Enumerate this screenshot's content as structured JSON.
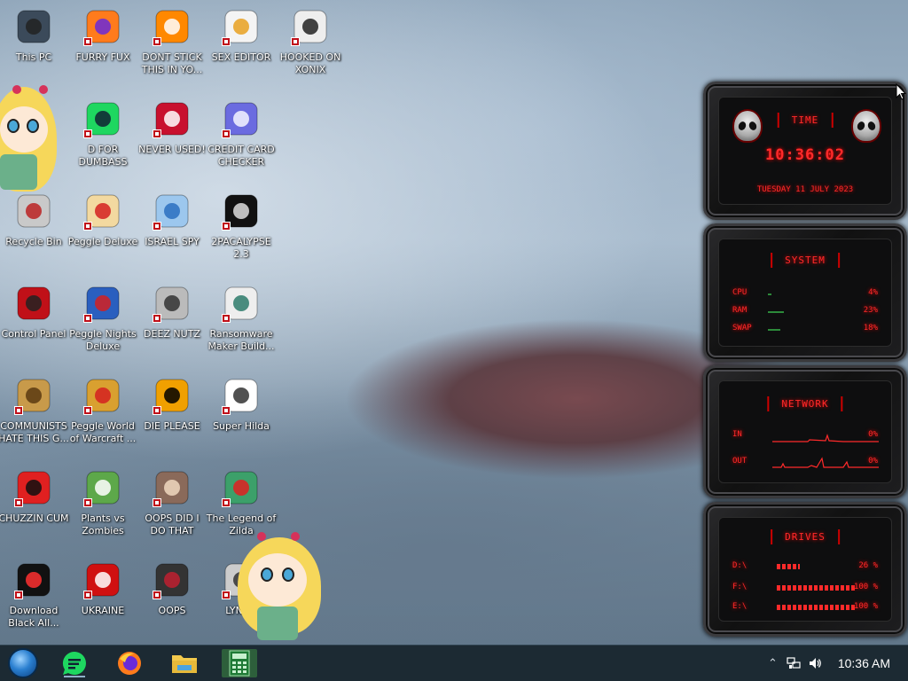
{
  "desktop": {
    "icons": [
      {
        "label": "This PC",
        "icon": "computer-icon"
      },
      {
        "label": "FURRY FUX",
        "icon": "firefox-icon"
      },
      {
        "label": "DONT STICK THIS IN YO...",
        "icon": "vlc-cone-icon"
      },
      {
        "label": "SEX EDITOR",
        "icon": "hxd-icon"
      },
      {
        "label": "HOOKED ON XONIX",
        "icon": "xonix-icon"
      },
      {
        "label": "D FOR DUMBASS",
        "icon": "dumbass-icon"
      },
      {
        "label": "NEVER USED!",
        "icon": "devcpp-icon"
      },
      {
        "label": "CREDIT CARD CHECKER",
        "icon": "credit-card-icon"
      },
      {
        "label": "Recycle Bin",
        "icon": "recycle-bin-icon"
      },
      {
        "label": "Peggle Deluxe",
        "icon": "peggle-icon"
      },
      {
        "label": "ISRAEL SPY",
        "icon": "network-spy-icon"
      },
      {
        "label": "2PACALYPSE 2.3",
        "icon": "terminal-icon"
      },
      {
        "label": "Control Panel",
        "icon": "control-panel-icon"
      },
      {
        "label": "Peggle Nights Deluxe",
        "icon": "peggle-nights-icon"
      },
      {
        "label": "DEEZ NUTZ",
        "icon": "windows-stack-icon"
      },
      {
        "label": "Ransomware Maker Build...",
        "icon": "window-app-icon"
      },
      {
        "label": "COMMUNISTS HATE THIS G...",
        "icon": "money-bag-icon"
      },
      {
        "label": "Peggle World of Warcraft ...",
        "icon": "peggle-wow-icon"
      },
      {
        "label": "DIE PLEASE",
        "icon": "de-icon"
      },
      {
        "label": "Super Hilda",
        "icon": "pixel-character-icon"
      },
      {
        "label": "CHUZZIN CUM",
        "icon": "chuzzle-icon"
      },
      {
        "label": "Plants vs Zombies",
        "icon": "pvz-icon"
      },
      {
        "label": "OOPS DID I DO THAT",
        "icon": "portrait-icon"
      },
      {
        "label": "The Legend of Zilda",
        "icon": "zilda-icon"
      },
      {
        "label": "Download Black All...",
        "icon": "black-orb-icon"
      },
      {
        "label": "UKRAINE",
        "icon": "radiation-icon"
      },
      {
        "label": "OOPS",
        "icon": "oops-icon"
      },
      {
        "label": "LYNCH",
        "icon": "magnifier-icon"
      }
    ]
  },
  "widget": {
    "time": {
      "title": "TIME",
      "clock": "10:36:02",
      "date": "TUESDAY 11 JULY 2023"
    },
    "system": {
      "title": "SYSTEM",
      "rows": [
        {
          "label": "CPU",
          "value": "4%",
          "level": 0.04
        },
        {
          "label": "RAM",
          "value": "23%",
          "level": 0.23
        },
        {
          "label": "SWAP",
          "value": "18%",
          "level": 0.18
        }
      ]
    },
    "network": {
      "title": "NETWORK",
      "rows": [
        {
          "label": "IN",
          "value": "0%"
        },
        {
          "label": "OUT",
          "value": "0%"
        }
      ]
    },
    "drives": {
      "title": "DRIVES",
      "rows": [
        {
          "label": "D:\\",
          "value": "26 %",
          "level": 0.26
        },
        {
          "label": "F:\\",
          "value": "100 %",
          "level": 1.0
        },
        {
          "label": "E:\\",
          "value": "100 %",
          "level": 1.0
        }
      ]
    }
  },
  "taskbar": {
    "start": "start-orb-icon",
    "pinned": [
      "dumbass-icon",
      "firefox-icon",
      "file-explorer-icon",
      "calculator-icon"
    ],
    "tray_icons": [
      "chevron-up-icon",
      "network-icon",
      "volume-icon"
    ],
    "clock": "10:36 AM"
  },
  "colors": {
    "widget_red": "#ff2a2a",
    "taskbar": "#1c2a33",
    "meter_green": "#2c8a3a"
  }
}
